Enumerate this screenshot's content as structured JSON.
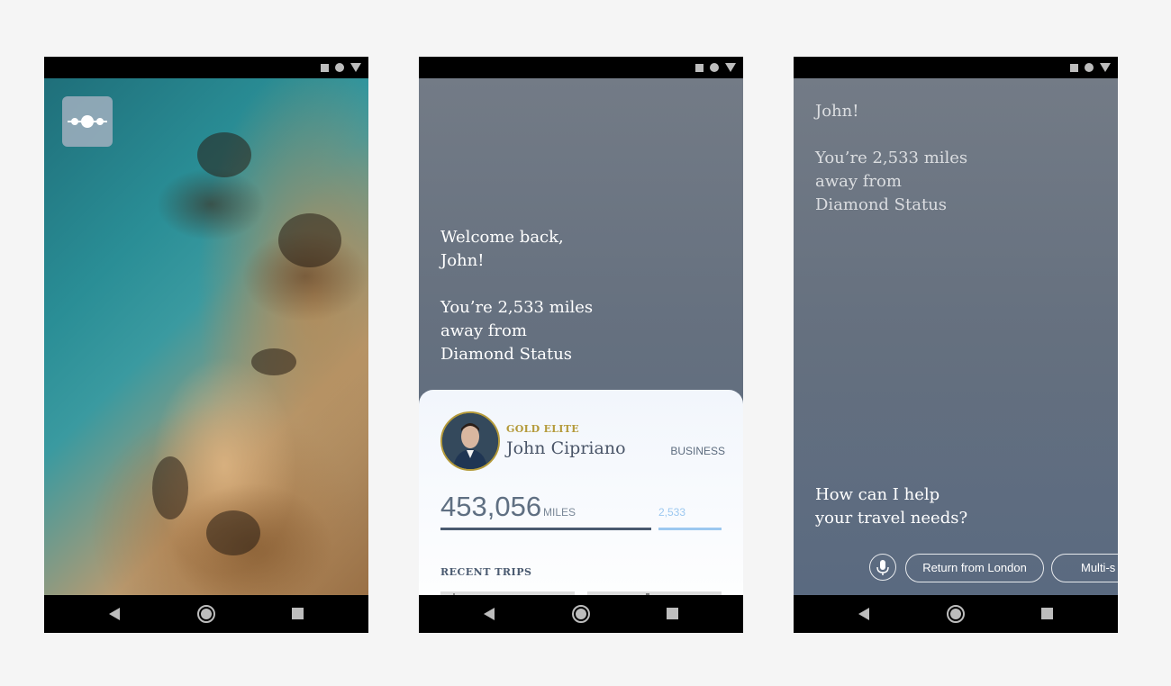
{
  "phone2": {
    "welcome_line1": "Welcome back,",
    "welcome_line2": "John!",
    "miles_line1": "You’re 2,533 miles",
    "miles_line2": "away from",
    "miles_line3": "Diamond Status",
    "card": {
      "tier": "GOLD ELITE",
      "name": "John Cipriano",
      "cabin": "BUSINESS",
      "miles_value": "453,056",
      "miles_unit": "MILES",
      "miles_remaining": "2,533",
      "recent_trips_title": "RECENT TRIPS"
    }
  },
  "phone3": {
    "greeting_line1": "John!",
    "miles_line1": "You’re 2,533 miles",
    "miles_line2": "away from",
    "miles_line3": "Diamond Status",
    "question_line1": "How can I help",
    "question_line2": "your travel needs?",
    "chips": [
      "Return from London",
      "Multi-s"
    ]
  },
  "colors": {
    "gold": "#b49a3a",
    "slate": "#5a6a80",
    "light_blue": "#9cc8f0"
  },
  "icons": {
    "status": [
      "square-icon",
      "circle-icon",
      "triangle-icon"
    ],
    "nav": [
      "back-icon",
      "home-icon",
      "recents-icon"
    ],
    "logo": "airline-logo-icon",
    "mic": "microphone-icon"
  }
}
